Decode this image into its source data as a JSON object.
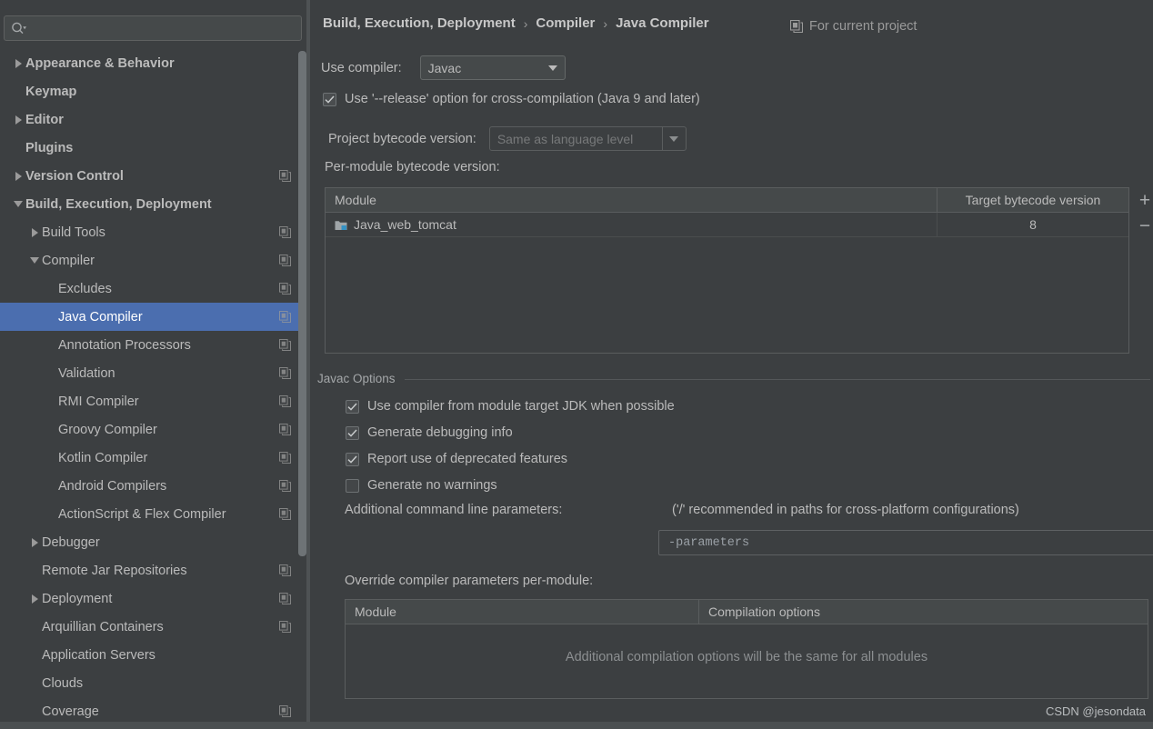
{
  "window": {
    "theme_bg": "#3c3f41",
    "accent": "#4b6eaf"
  },
  "sidebar": {
    "search": {
      "value": "",
      "placeholder": "",
      "icon": "search-icon",
      "dropdown_icon": "chevron-down-icon"
    },
    "items": [
      {
        "label": "Appearance & Behavior",
        "arrow": "right",
        "indent": 0,
        "bold": true,
        "badge": false,
        "selected": false
      },
      {
        "label": "Keymap",
        "arrow": "none",
        "indent": 0,
        "bold": true,
        "badge": false,
        "selected": false
      },
      {
        "label": "Editor",
        "arrow": "right",
        "indent": 0,
        "bold": true,
        "badge": false,
        "selected": false
      },
      {
        "label": "Plugins",
        "arrow": "none",
        "indent": 0,
        "bold": true,
        "badge": false,
        "selected": false
      },
      {
        "label": "Version Control",
        "arrow": "right",
        "indent": 0,
        "bold": true,
        "badge": true,
        "selected": false
      },
      {
        "label": "Build, Execution, Deployment",
        "arrow": "down",
        "indent": 0,
        "bold": true,
        "badge": false,
        "selected": false
      },
      {
        "label": "Build Tools",
        "arrow": "right",
        "indent": 1,
        "bold": false,
        "badge": true,
        "selected": false
      },
      {
        "label": "Compiler",
        "arrow": "down",
        "indent": 1,
        "bold": false,
        "badge": true,
        "selected": false
      },
      {
        "label": "Excludes",
        "arrow": "none",
        "indent": 2,
        "bold": false,
        "badge": true,
        "selected": false
      },
      {
        "label": "Java Compiler",
        "arrow": "none",
        "indent": 2,
        "bold": false,
        "badge": true,
        "selected": true
      },
      {
        "label": "Annotation Processors",
        "arrow": "none",
        "indent": 2,
        "bold": false,
        "badge": true,
        "selected": false
      },
      {
        "label": "Validation",
        "arrow": "none",
        "indent": 2,
        "bold": false,
        "badge": true,
        "selected": false
      },
      {
        "label": "RMI Compiler",
        "arrow": "none",
        "indent": 2,
        "bold": false,
        "badge": true,
        "selected": false
      },
      {
        "label": "Groovy Compiler",
        "arrow": "none",
        "indent": 2,
        "bold": false,
        "badge": true,
        "selected": false
      },
      {
        "label": "Kotlin Compiler",
        "arrow": "none",
        "indent": 2,
        "bold": false,
        "badge": true,
        "selected": false
      },
      {
        "label": "Android Compilers",
        "arrow": "none",
        "indent": 2,
        "bold": false,
        "badge": true,
        "selected": false
      },
      {
        "label": "ActionScript & Flex Compiler",
        "arrow": "none",
        "indent": 2,
        "bold": false,
        "badge": true,
        "selected": false
      },
      {
        "label": "Debugger",
        "arrow": "right",
        "indent": 1,
        "bold": false,
        "badge": false,
        "selected": false
      },
      {
        "label": "Remote Jar Repositories",
        "arrow": "none",
        "indent": 1,
        "bold": false,
        "badge": true,
        "selected": false
      },
      {
        "label": "Deployment",
        "arrow": "right",
        "indent": 1,
        "bold": false,
        "badge": true,
        "selected": false
      },
      {
        "label": "Arquillian Containers",
        "arrow": "none",
        "indent": 1,
        "bold": false,
        "badge": true,
        "selected": false
      },
      {
        "label": "Application Servers",
        "arrow": "none",
        "indent": 1,
        "bold": false,
        "badge": false,
        "selected": false
      },
      {
        "label": "Clouds",
        "arrow": "none",
        "indent": 1,
        "bold": false,
        "badge": false,
        "selected": false
      },
      {
        "label": "Coverage",
        "arrow": "none",
        "indent": 1,
        "bold": false,
        "badge": true,
        "selected": false
      }
    ]
  },
  "header": {
    "breadcrumb": [
      "Build, Execution, Deployment",
      "Compiler",
      "Java Compiler"
    ],
    "separator": "›",
    "scope_label": "For current project",
    "scope_icon": "copy-icon"
  },
  "main": {
    "use_compiler_label": "Use compiler:",
    "use_compiler_value": "Javac",
    "release_option_label": "Use '--release' option for cross-compilation (Java 9 and later)",
    "release_option_checked": true,
    "project_bytecode_label": "Project bytecode version:",
    "project_bytecode_value": "Same as language level",
    "project_bytecode_disabled": true,
    "per_module_label": "Per-module bytecode version:",
    "per_module_table": {
      "columns": [
        "Module",
        "Target bytecode version"
      ],
      "rows": [
        {
          "module": "Java_web_tomcat",
          "target": "8",
          "icon": "module-icon"
        }
      ],
      "add_button": "+",
      "remove_button": "−"
    },
    "javac_group_title": "Javac Options",
    "javac_checkboxes": [
      {
        "label": "Use compiler from module target JDK when possible",
        "checked": true
      },
      {
        "label": "Generate debugging info",
        "checked": true
      },
      {
        "label": "Report use of deprecated features",
        "checked": true
      },
      {
        "label": "Generate no warnings",
        "checked": false
      }
    ],
    "additional_params_label": "Additional command line parameters:",
    "additional_params_hint": "('/' recommended in paths for cross-platform configurations)",
    "additional_params_value": "-parameters",
    "expand_icon": "expand-icon",
    "override_label": "Override compiler parameters per-module:",
    "override_table": {
      "columns": [
        "Module",
        "Compilation options"
      ],
      "empty_message": "Additional compilation options will be the same for all modules",
      "add_button": "+",
      "remove_button": "−"
    }
  },
  "watermark": "CSDN @jesondata"
}
